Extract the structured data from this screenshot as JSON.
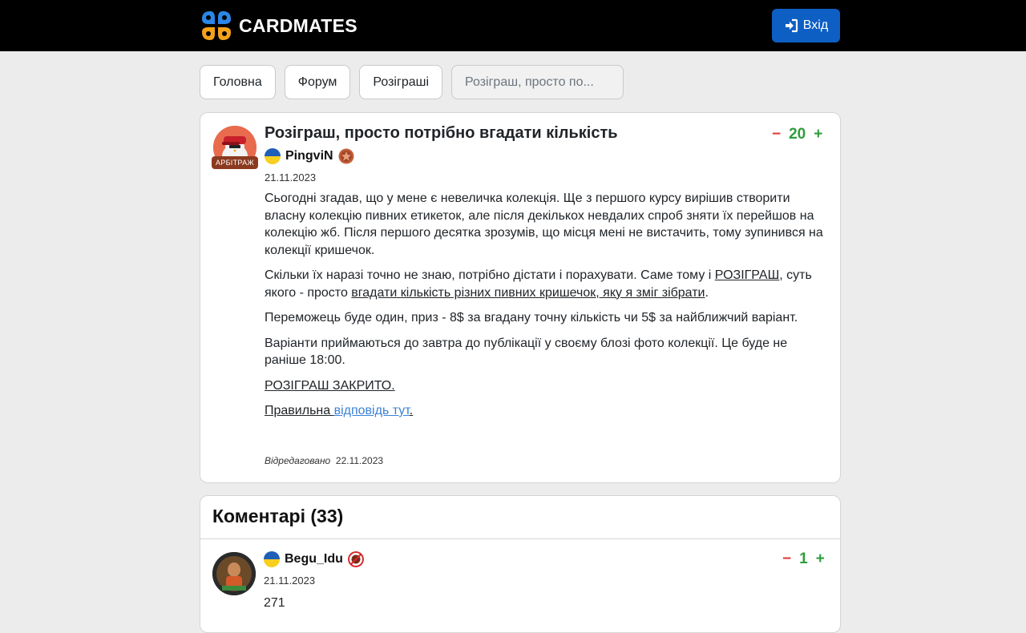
{
  "header": {
    "logo_text": "CARDMATES",
    "login_label": "Вхід"
  },
  "nav": {
    "items": [
      "Головна",
      "Форум",
      "Розіграші"
    ],
    "current": "Розіграш, просто по..."
  },
  "post": {
    "title": "Розіграш, просто потрібно вгадати кількість",
    "author": "PingviN",
    "author_badge": "АРБІТРАЖ",
    "date": "21.11.2023",
    "score": "20",
    "minus": "−",
    "plus": "+",
    "p1": "Сьогодні згадав, що у мене є невеличка колекція. Ще з першого курсу вирішив створити власну колекцію пивних етикеток, але після декількох невдалих спроб зняти їх перейшов на колекцію жб. Після першого десятка зрозумів, що місця мені не вистачить, тому зупинився на колекції кришечок.",
    "p2_a": "Скільки їх наразі точно не знаю, потрібно дістати і порахувати. Саме тому і ",
    "p2_b": "РОЗІГРАШ",
    "p2_c": ", суть якого - просто ",
    "p2_d": "вгадати кількість різних пивних кришечок, яку я зміг зібрати",
    "p2_e": ".",
    "p3": "Переможець буде один, приз - 8$ за вгадану точну кількість чи 5$ за найближчий варіант.",
    "p4": "Варіанти приймаються до завтра до публікації у своєму блозі фото колекції. Це буде не раніше 18:00.",
    "p5": "РОЗІГРАШ ЗАКРИТО.",
    "p6_a": "Правильна ",
    "p6_b": "відповідь тут",
    "p6_c": ".",
    "edited_label": "Відредаговано",
    "edited_date": "22.11.2023"
  },
  "comments": {
    "heading": "Коментарі (33)",
    "items": [
      {
        "author": "Begu_Idu",
        "date": "21.11.2023",
        "text": "271",
        "score": "1",
        "minus": "−",
        "plus": "+"
      }
    ]
  },
  "colors": {
    "accent": "#0d5fc4",
    "vote_up": "#2e9e3b",
    "vote_down": "#e53935",
    "link": "#3b82d6"
  }
}
